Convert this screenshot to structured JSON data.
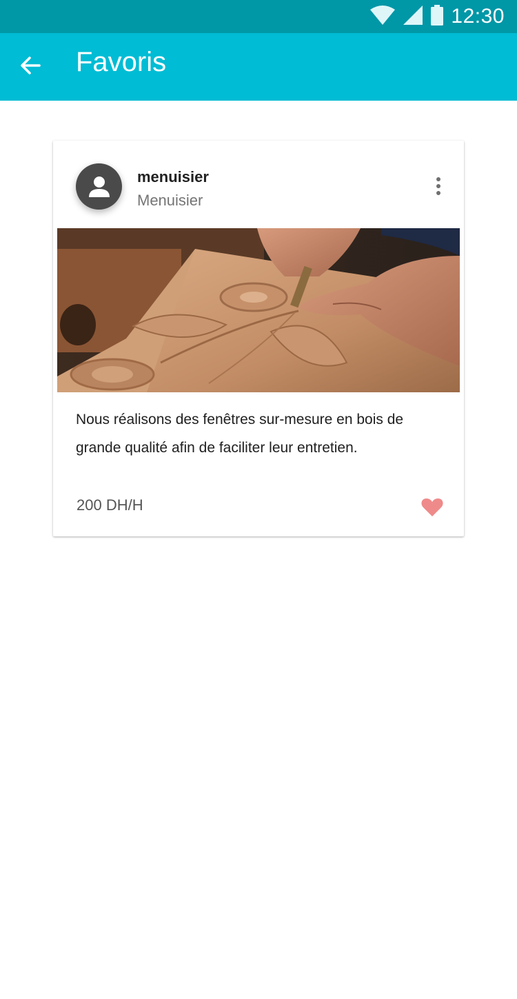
{
  "status_bar": {
    "time": "12:30",
    "icons": [
      "wifi-icon",
      "signal-icon",
      "battery-icon"
    ]
  },
  "app_bar": {
    "title": "Favoris",
    "back_icon": "arrow-back-icon"
  },
  "card": {
    "name": "menuisier",
    "category": "Menuisier",
    "description": "Nous réalisons des fenêtres sur-mesure en bois de grande qualité afin de faciliter leur entretien.",
    "price": "200 DH/H",
    "image": "wood-carving-photo",
    "favorited": true
  },
  "colors": {
    "status_bar": "#0097a7",
    "app_bar": "#00bcd4",
    "heart": "#ef8a8a",
    "avatar": "#4a4a4a"
  }
}
